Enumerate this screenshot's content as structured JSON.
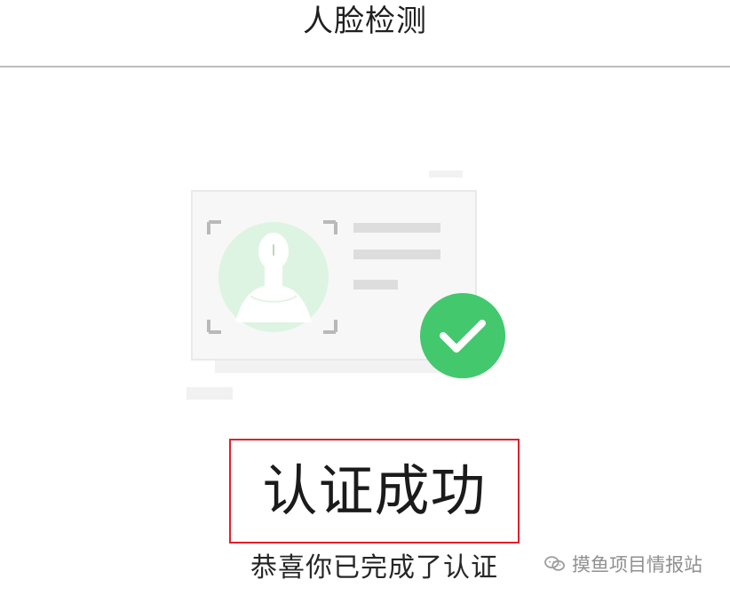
{
  "header": {
    "title": "人脸检测"
  },
  "result": {
    "title": "认证成功",
    "description": "恭喜你已完成了认证"
  },
  "watermark": {
    "text": "摸鱼项目情报站"
  },
  "colors": {
    "success_green": "#43c86d",
    "avatar_green": "#dff4e3",
    "highlight_red": "#e2202b",
    "divider_gray": "#bdbdbd"
  },
  "icons": {
    "verification_card": "id-card-illustration",
    "success_check": "check-circle-icon",
    "watermark_logo": "wechat-logo-icon"
  }
}
